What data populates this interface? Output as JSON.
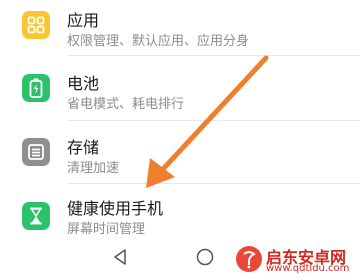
{
  "settings": {
    "items": [
      {
        "title": "应用",
        "subtitle": "权限管理、默认应用、应用分身",
        "icon": "apps-grid-icon",
        "icon_color": "#f8c630"
      },
      {
        "title": "电池",
        "subtitle": "省电模式、耗电排行",
        "icon": "battery-icon",
        "icon_color": "#2cc26a"
      },
      {
        "title": "存储",
        "subtitle": "清理加速",
        "icon": "storage-icon",
        "icon_color": "#8e8e93"
      },
      {
        "title": "健康使用手机",
        "subtitle": "屏幕时间管理",
        "icon": "hourglass-icon",
        "icon_color": "#2cc26a"
      }
    ]
  },
  "navbar": {
    "back": "back-icon",
    "home": "home-icon"
  },
  "annotation": {
    "arrow_color": "#f07f2c"
  },
  "watermark": {
    "name": "启东安卓网",
    "url": "www.qdtldu.com"
  }
}
